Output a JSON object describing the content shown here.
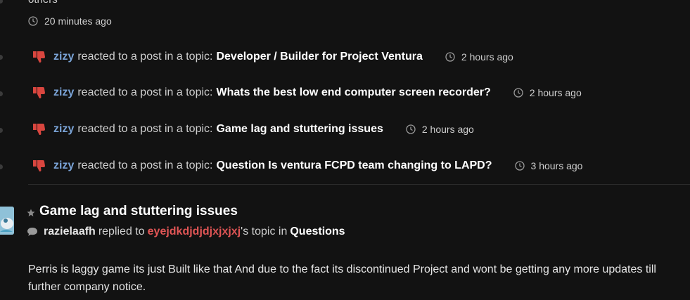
{
  "top_fragment": "others",
  "top_time": "20 minutes ago",
  "reactions": [
    {
      "user": "zizy",
      "action": "reacted to a post in a topic:",
      "topic": "Developer / Builder for Project Ventura",
      "time": "2 hours ago"
    },
    {
      "user": "zizy",
      "action": "reacted to a post in a topic:",
      "topic": "Whats the best low end computer screen recorder?",
      "time": "2 hours ago"
    },
    {
      "user": "zizy",
      "action": "reacted to a post in a topic:",
      "topic": "Game lag and stuttering issues",
      "time": "2 hours ago"
    },
    {
      "user": "zizy",
      "action": "reacted to a post in a topic:",
      "topic": "Question Is ventura FCPD team changing to LAPD?",
      "time": "3 hours ago"
    }
  ],
  "entry": {
    "title": "Game lag and stuttering issues",
    "reply_user": "razielaafh",
    "reply_text": "replied to",
    "reply_author": "eyejdkdjdjdjxjxjxj",
    "reply_suffix": "'s topic in",
    "reply_forum": "Questions",
    "excerpt": "Perris is laggy game its just Built like that And due to the fact its discontinued Project and wont be getting any more updates till further company notice."
  },
  "colors": {
    "background": "#121212",
    "username": "#7aa3d6",
    "author": "#e05555",
    "reaction_icon": "#d9463f"
  },
  "icons": {
    "reaction": "thumbs-down-icon",
    "time": "clock-icon",
    "title": "star-icon",
    "reply": "speech-bubble-icon"
  }
}
